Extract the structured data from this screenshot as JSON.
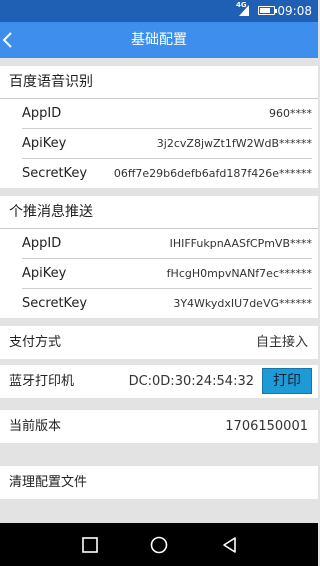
{
  "status_bar": {
    "network": "4G",
    "time": "09:08"
  },
  "header": {
    "title": "基础配置"
  },
  "baidu": {
    "title": "百度语音识别",
    "rows": [
      {
        "key": "AppID",
        "value": "960****"
      },
      {
        "key": "ApiKey",
        "value": "3j2cvZ8jwZt1fW2WdB******"
      },
      {
        "key": "SecretKey",
        "value": "06ff7e29b6defb6afd187f426e******"
      }
    ]
  },
  "getui": {
    "title": "个推消息推送",
    "rows": [
      {
        "key": "AppID",
        "value": "IHIFFukpnAASfCPmVB****"
      },
      {
        "key": "ApiKey",
        "value": "fHcgH0mpvNANf7ec******"
      },
      {
        "key": "SecretKey",
        "value": "3Y4WkydxIU7deVG******"
      }
    ]
  },
  "payment": {
    "label": "支付方式",
    "value": "自主接入"
  },
  "printer": {
    "label": "蓝牙打印机",
    "mac": "DC:0D:30:24:54:32",
    "button": "打印"
  },
  "version": {
    "label": "当前版本",
    "value": "1706150001"
  },
  "clear": {
    "label": "清理配置文件"
  },
  "icons": {
    "back": "chevron-left-icon",
    "nav_recent": "square-icon",
    "nav_home": "circle-icon",
    "nav_back": "triangle-back-icon"
  },
  "colors": {
    "status_bar": "#1f5fb4",
    "header": "#3e8eee",
    "print_button": "#1e9bd7"
  }
}
